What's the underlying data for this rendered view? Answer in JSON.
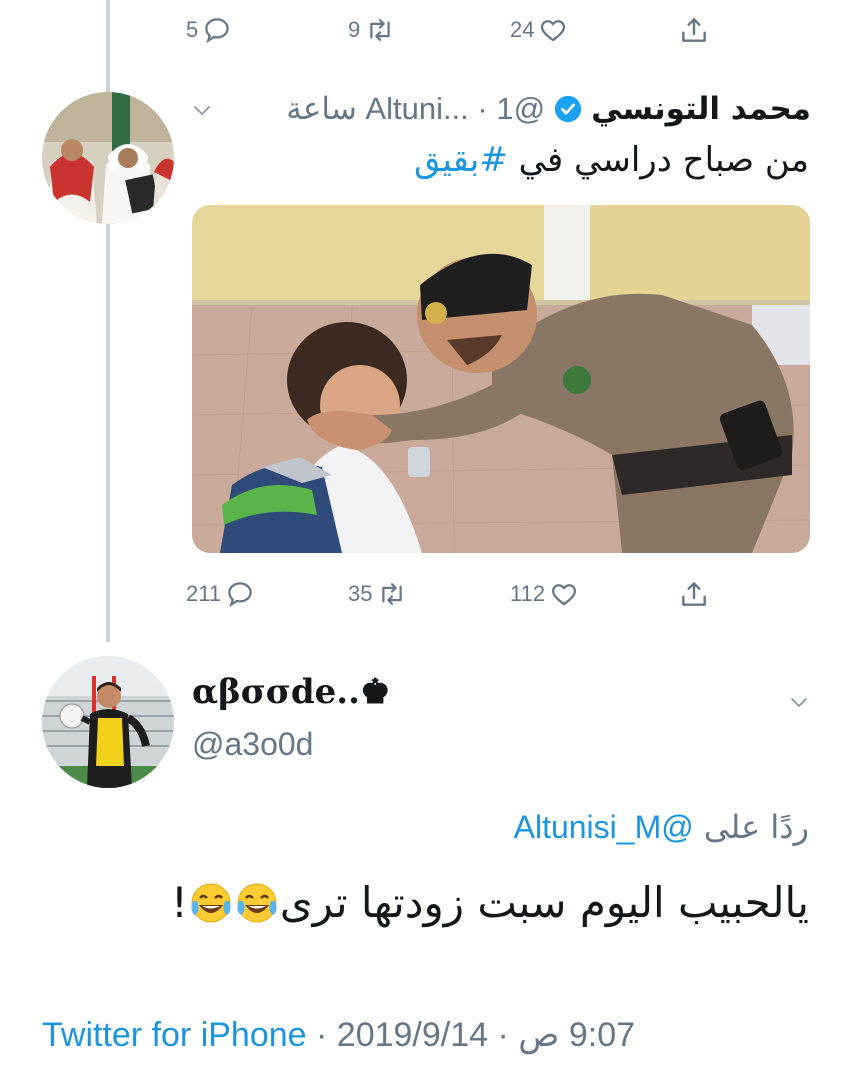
{
  "top_actions": {
    "replies": "5",
    "retweets": "9",
    "likes": "24"
  },
  "parent_tweet": {
    "display_name": "محمد التونسي",
    "handle_time": "@Altuni... · 1 ساعة",
    "text_main": "من صباح دراسي في ",
    "hashtag": "#بقيق",
    "actions": {
      "replies": "211",
      "retweets": "35",
      "likes": "112"
    }
  },
  "reply_tweet": {
    "display_name": "αβσσde..♚",
    "handle": "@a3o0d",
    "replying_prefix": "ردًا على ",
    "replying_to": "@Altunisi_M",
    "text": "يالحبيب اليوم سبت زودتها ترى ",
    "text_end": "!",
    "timestamp": "9:07 ص · 2019/9/14 · ",
    "source": "Twitter for iPhone"
  },
  "icons": [
    "reply-icon",
    "retweet-icon",
    "like-icon",
    "share-icon",
    "verified-icon",
    "chevron-down-icon",
    "laughing-crying-emoji"
  ],
  "colors": {
    "link": "#1b95e0",
    "secondary": "#657786",
    "text": "#14171a",
    "verified": "#1da1f2",
    "thread": "#c9d3db"
  }
}
